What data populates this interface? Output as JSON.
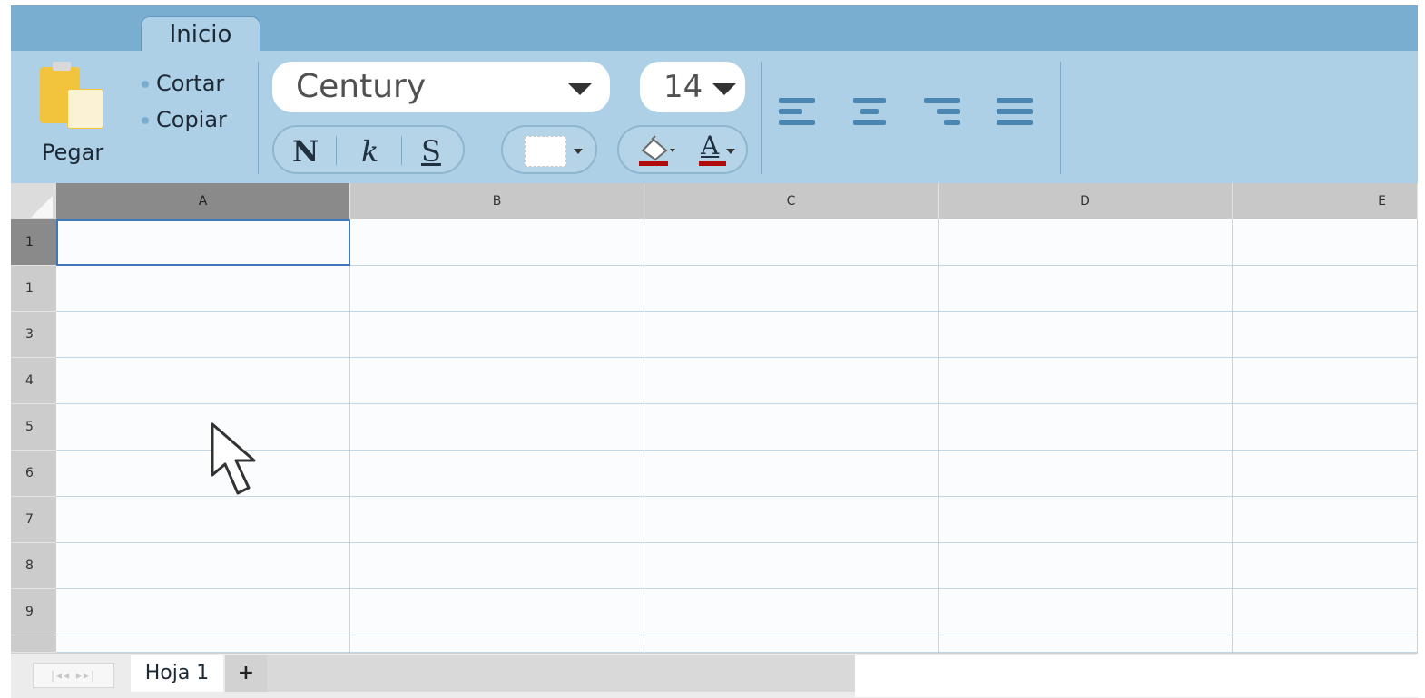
{
  "tabs": [
    {
      "label": "Inicio"
    }
  ],
  "clipboard": {
    "paste_label": "Pegar",
    "cut_label": "Cortar",
    "copy_label": "Copiar"
  },
  "font": {
    "family_value": "Century",
    "size_value": "14"
  },
  "format_buttons": {
    "bold": "N",
    "italic": "k",
    "underline": "S"
  },
  "font_color_glyph": "A",
  "alignment": [
    "left",
    "center",
    "right",
    "justify"
  ],
  "columns": [
    "A",
    "B",
    "C",
    "D",
    "E"
  ],
  "rows": [
    "1",
    "1",
    "3",
    "4",
    "5",
    "6",
    "7",
    "8",
    "9"
  ],
  "selected_cell": {
    "column": "A",
    "row": "1"
  },
  "sheets": {
    "tabs": [
      "Hoja 1"
    ],
    "add_label": "+"
  },
  "colors": {
    "accent": "#7aaed0",
    "ribbon": "#aed0e6",
    "selection": "#3d78b8",
    "font_color": "#b10c0c",
    "paste_icon": "#f2c33c"
  }
}
